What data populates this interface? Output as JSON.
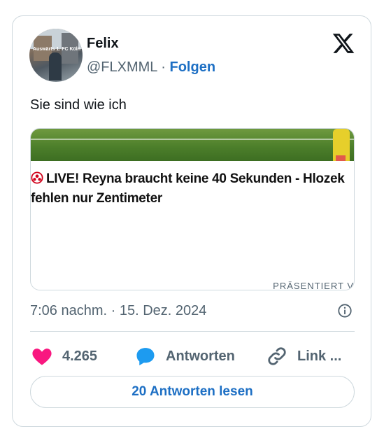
{
  "author": {
    "name": "Felix",
    "handle": "@FLXMML",
    "separator": "·",
    "follow_label": "Folgen",
    "avatar_text": "Auswärts 1. FC Köln"
  },
  "tweet": {
    "text": "Sie sind wie ich",
    "timestamp": "7:06 nachm. · 15. Dez. 2024"
  },
  "link_card": {
    "headline_line1": "LIVE! Reyna braucht keine 40 Sekunden - Hlozek",
    "headline_line2": "fehlen nur Zentimeter",
    "presented_label": "PRÄSENTIERT V"
  },
  "actions": {
    "likes_count": "4.265",
    "reply_label": "Antworten",
    "link_label": "Link ..."
  },
  "read_replies_label": "20 Antworten lesen",
  "colors": {
    "link_blue": "#1d6fc4",
    "like_pink": "#f91880",
    "reply_blue": "#1d9bf0",
    "muted": "#536471",
    "border": "#cfd9de"
  },
  "icons": [
    "x-logo-icon",
    "info-icon",
    "heart-icon",
    "speech-bubble-icon",
    "chain-link-icon",
    "football-icon"
  ]
}
